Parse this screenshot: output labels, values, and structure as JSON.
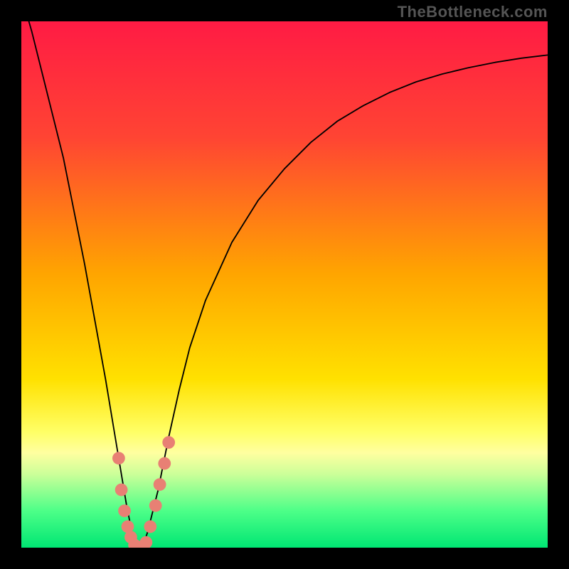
{
  "credit": "TheBottleneck.com",
  "chart_data": {
    "type": "line",
    "title": "",
    "xlabel": "",
    "ylabel": "",
    "xlim": [
      0,
      100
    ],
    "ylim": [
      0,
      100
    ],
    "background_gradient_stops": [
      {
        "offset": 0,
        "color": "#ff1b44"
      },
      {
        "offset": 22,
        "color": "#ff4433"
      },
      {
        "offset": 48,
        "color": "#ffa500"
      },
      {
        "offset": 68,
        "color": "#ffe100"
      },
      {
        "offset": 78,
        "color": "#ffff66"
      },
      {
        "offset": 82,
        "color": "#ffffa0"
      },
      {
        "offset": 86,
        "color": "#ccff99"
      },
      {
        "offset": 93,
        "color": "#4dff88"
      },
      {
        "offset": 100,
        "color": "#00e673"
      }
    ],
    "series": [
      {
        "name": "bottleneck-curve",
        "x": [
          0,
          2,
          4,
          6,
          8,
          10,
          12,
          14,
          16,
          18,
          19,
          20,
          21,
          22,
          23,
          24,
          25,
          26,
          27,
          28,
          30,
          32,
          35,
          40,
          45,
          50,
          55,
          60,
          65,
          70,
          75,
          80,
          85,
          90,
          95,
          100
        ],
        "y": [
          105,
          98,
          90,
          82,
          74,
          64,
          54,
          43,
          32,
          20,
          14,
          8,
          3,
          0,
          0,
          3,
          7,
          11,
          16,
          21,
          30,
          38,
          47,
          58,
          66,
          72,
          77,
          81,
          84,
          86.5,
          88.5,
          90,
          91.2,
          92.2,
          93,
          93.6
        ]
      }
    ],
    "markers": {
      "name": "marker-dots",
      "color": "#e88074",
      "radius": 1.2,
      "points": [
        {
          "x": 18.5,
          "y": 17
        },
        {
          "x": 19.0,
          "y": 11
        },
        {
          "x": 19.6,
          "y": 7
        },
        {
          "x": 20.2,
          "y": 4
        },
        {
          "x": 20.8,
          "y": 2
        },
        {
          "x": 21.5,
          "y": 0.5
        },
        {
          "x": 22.3,
          "y": 0.1
        },
        {
          "x": 23.0,
          "y": 0.1
        },
        {
          "x": 23.7,
          "y": 1
        },
        {
          "x": 24.5,
          "y": 4
        },
        {
          "x": 25.5,
          "y": 8
        },
        {
          "x": 26.3,
          "y": 12
        },
        {
          "x": 27.2,
          "y": 16
        },
        {
          "x": 28.0,
          "y": 20
        }
      ]
    }
  }
}
